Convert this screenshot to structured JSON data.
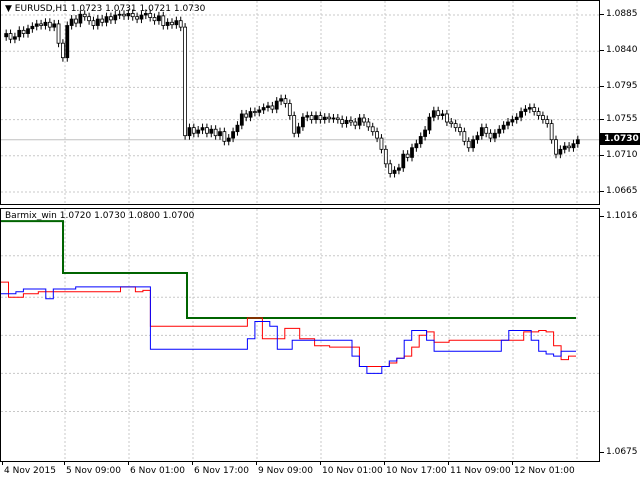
{
  "main_chart": {
    "symbol_label": "EURUSD,H1",
    "ohlc": "1.0723 1.0731 1.0721 1.0730",
    "current_price": "1.0730",
    "price_labels": [
      "1.0885",
      "1.0840",
      "1.0795",
      "1.0755",
      "1.0710",
      "1.0665"
    ],
    "candle_closes": [
      1.0862,
      1.0855,
      1.0858,
      1.0866,
      1.0862,
      1.0868,
      1.0871,
      1.0874,
      1.0872,
      1.0876,
      1.087,
      1.0874,
      1.085,
      1.0832,
      1.0872,
      1.088,
      1.0875,
      1.0886,
      1.0883,
      1.0878,
      1.0872,
      1.088,
      1.0876,
      1.0883,
      1.0879,
      1.0885,
      1.0886,
      1.0884,
      1.0887,
      1.0883,
      1.088,
      1.0885,
      1.0887,
      1.0882,
      1.0878,
      1.0884,
      1.0872,
      1.0876,
      1.0873,
      1.0878,
      1.087,
      1.0735,
      1.0745,
      1.0738,
      1.0742,
      1.0745,
      1.0738,
      1.0743,
      1.0735,
      1.074,
      1.0728,
      1.0732,
      1.074,
      1.0748,
      1.0762,
      1.0758,
      1.0765,
      1.0764,
      1.0767,
      1.077,
      1.0772,
      1.0768,
      1.0778,
      1.0781,
      1.0775,
      1.076,
      1.0738,
      1.0746,
      1.0758,
      1.076,
      1.0755,
      1.076,
      1.0755,
      1.0758,
      1.0756,
      1.0757,
      1.0755,
      1.075,
      1.0754,
      1.0752,
      1.0748,
      1.0757,
      1.0752,
      1.0746,
      1.074,
      1.0732,
      1.0718,
      1.07,
      1.0688,
      1.0692,
      1.0695,
      1.0712,
      1.0708,
      1.072,
      1.0725,
      1.0734,
      1.0742,
      1.0758,
      1.0766,
      1.076,
      1.0762,
      1.0752,
      1.075,
      1.0745,
      1.074,
      1.0728,
      1.072,
      1.073,
      1.0735,
      1.0745,
      1.0738,
      1.0732,
      1.0738,
      1.0743,
      1.0748,
      1.0752,
      1.0755,
      1.0758,
      1.0765,
      1.0768,
      1.077,
      1.0765,
      1.076,
      1.0755,
      1.075,
      1.073,
      1.0712,
      1.0718,
      1.0722,
      1.072,
      1.0725,
      1.073
    ]
  },
  "indicator": {
    "label": "Barmix_win 1.0720 1.0730 1.0800 1.0700",
    "scale_labels": [
      "1.1016",
      "1.0675"
    ],
    "green_line": [
      [
        0,
        1.101
      ],
      [
        60,
        1.101
      ],
      [
        60,
        1.0935
      ],
      [
        80,
        1.0935
      ],
      [
        80,
        1.087
      ],
      [
        570,
        1.087
      ]
    ],
    "red_line": [
      1.0922,
      1.09,
      1.09,
      1.0905,
      1.0905,
      1.0908,
      1.0908,
      1.0908,
      1.0908,
      1.0908,
      1.0908,
      1.0908,
      1.0908,
      1.0908,
      1.0908,
      1.0908,
      1.0915,
      1.0915,
      1.0908,
      1.091,
      1.0858,
      1.0858,
      1.0858,
      1.0858,
      1.0858,
      1.0858,
      1.0858,
      1.0858,
      1.0858,
      1.0858,
      1.0858,
      1.0858,
      1.0858,
      1.087,
      1.087,
      1.084,
      1.084,
      1.084,
      1.0855,
      1.0855,
      1.084,
      1.084,
      1.083,
      1.083,
      1.0828,
      1.0828,
      1.0828,
      1.0828,
      1.08,
      1.08,
      1.08,
      1.08,
      1.0805,
      1.0812,
      1.0815,
      1.0828,
      1.0845,
      1.085,
      1.0835,
      1.0835,
      1.0838,
      1.0838,
      1.0838,
      1.0838,
      1.0838,
      1.0838,
      1.0838,
      1.0838,
      1.0838,
      1.0838,
      1.085,
      1.085,
      1.0852,
      1.085,
      1.083,
      1.081,
      1.0815
    ],
    "blue_line": [
      1.0905,
      1.0905,
      1.0908,
      1.0912,
      1.0912,
      1.0912,
      1.0898,
      1.0912,
      1.0912,
      1.0912,
      1.0915,
      1.0915,
      1.0915,
      1.0915,
      1.0915,
      1.0915,
      1.0915,
      1.0915,
      1.0915,
      1.0915,
      1.0825,
      1.0825,
      1.0825,
      1.0825,
      1.0825,
      1.0825,
      1.0825,
      1.0825,
      1.0825,
      1.0825,
      1.0825,
      1.0825,
      1.0825,
      1.084,
      1.0865,
      1.0865,
      1.0858,
      1.0825,
      1.0825,
      1.0838,
      1.0838,
      1.0838,
      1.0838,
      1.0838,
      1.0838,
      1.0838,
      1.0838,
      1.0815,
      1.08,
      1.079,
      1.079,
      1.08,
      1.0808,
      1.0812,
      1.0838,
      1.0852,
      1.0852,
      1.0838,
      1.0822,
      1.0822,
      1.0822,
      1.0822,
      1.0822,
      1.0822,
      1.0822,
      1.0822,
      1.0822,
      1.0838,
      1.0852,
      1.0852,
      1.0852,
      1.0838,
      1.0822,
      1.0818,
      1.0815,
      1.0822,
      1.0822
    ]
  },
  "time_labels": [
    "4 Nov 2015",
    "5 Nov 09:00",
    "6 Nov 01:00",
    "6 Nov 17:00",
    "9 Nov 09:00",
    "10 Nov 01:00",
    "10 Nov 17:00",
    "11 Nov 09:00",
    "12 Nov 01:00"
  ],
  "colors": {
    "bull": "#000000",
    "grid": "#c8c8c8",
    "green": "#006400",
    "red": "#ff0000",
    "blue": "#0000ff"
  }
}
